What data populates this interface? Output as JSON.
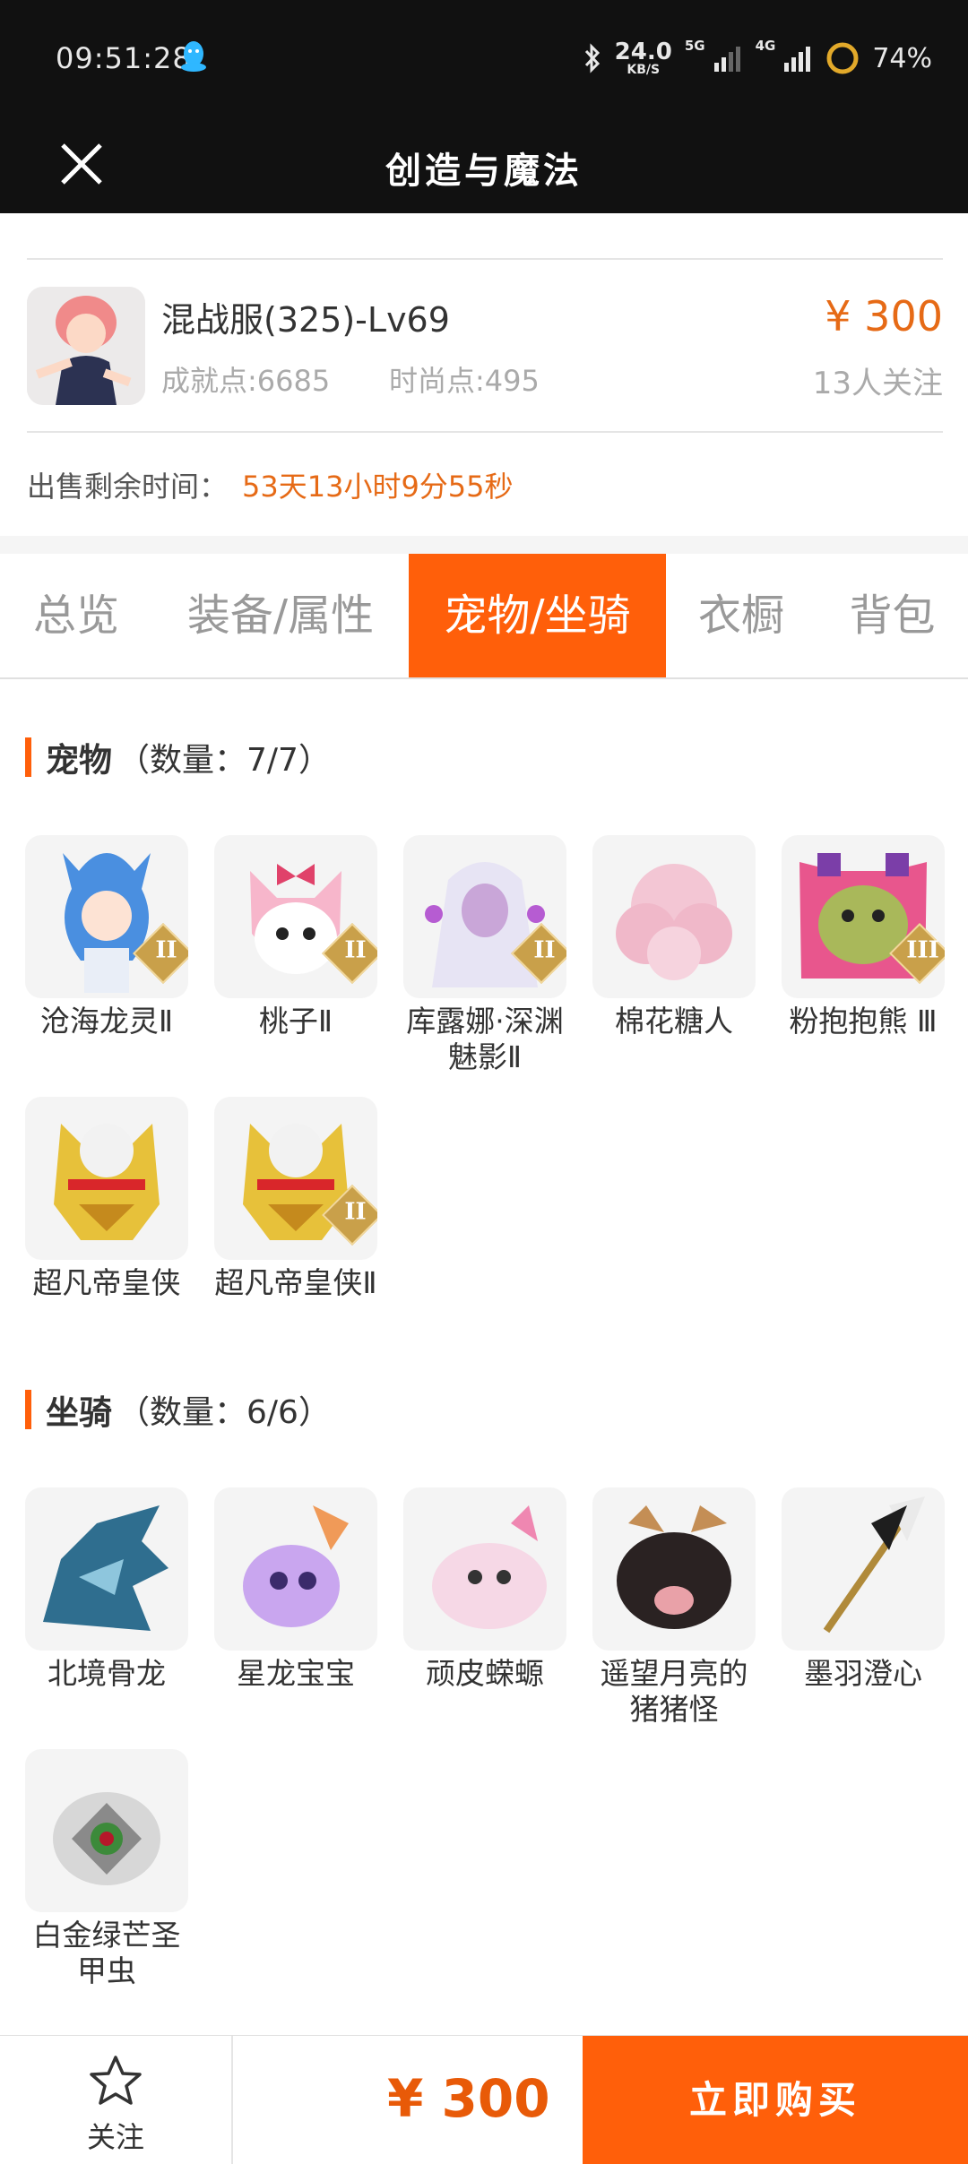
{
  "status_bar": {
    "time": "09:51:28",
    "net_speed": "24.0",
    "net_speed_unit": "KB/S",
    "net_type_1": "5G",
    "net_type_2": "4G",
    "battery": "74%"
  },
  "nav": {
    "title": "创造与魔法"
  },
  "product": {
    "name": "混战服(325)-Lv69",
    "achievement": "成就点:6685",
    "fashion": "时尚点:495",
    "price": "¥ 300",
    "followers": "13人关注",
    "sale_label": "出售剩余时间：",
    "sale_time": "53天13小时9分55秒"
  },
  "tabs": [
    {
      "label": "总览"
    },
    {
      "label": "装备/属性"
    },
    {
      "label": "宠物/坐骑"
    },
    {
      "label": "衣橱"
    },
    {
      "label": "背包"
    }
  ],
  "pets": {
    "title": "宠物",
    "count": "（数量：7/7）",
    "items": [
      {
        "name": "沧海龙灵Ⅱ",
        "badge": "II",
        "icon": "blue-dragon-spirit"
      },
      {
        "name": "桃子Ⅱ",
        "badge": "II",
        "icon": "pink-fox"
      },
      {
        "name": "库露娜·深渊魅影Ⅱ",
        "badge": "II",
        "icon": "white-hair-girl"
      },
      {
        "name": "棉花糖人",
        "badge": "",
        "icon": "pink-fluff"
      },
      {
        "name": "粉抱抱熊 Ⅲ",
        "badge": "III",
        "icon": "pink-bear"
      },
      {
        "name": "超凡帝皇侠",
        "badge": "",
        "icon": "gold-armor"
      },
      {
        "name": "超凡帝皇侠Ⅱ",
        "badge": "II",
        "icon": "gold-armor"
      }
    ]
  },
  "mounts": {
    "title": "坐骑",
    "count": "（数量：6/6）",
    "items": [
      {
        "name": "北境骨龙",
        "icon": "bone-dragon"
      },
      {
        "name": "星龙宝宝",
        "icon": "star-dragon"
      },
      {
        "name": "顽皮蝾螈",
        "icon": "axolotl"
      },
      {
        "name": "遥望月亮的猪猪怪",
        "icon": "black-pig"
      },
      {
        "name": "墨羽澄心",
        "icon": "feather-trident"
      },
      {
        "name": "白金绿芒圣甲虫",
        "icon": "silver-beetle"
      }
    ]
  },
  "bottom": {
    "follow_label": "关注",
    "price": "¥ 300",
    "buy_label": "立即购买"
  },
  "colors": {
    "accent": "#ff5f0a",
    "price": "#e66a16",
    "badge": "#c9a04a"
  }
}
